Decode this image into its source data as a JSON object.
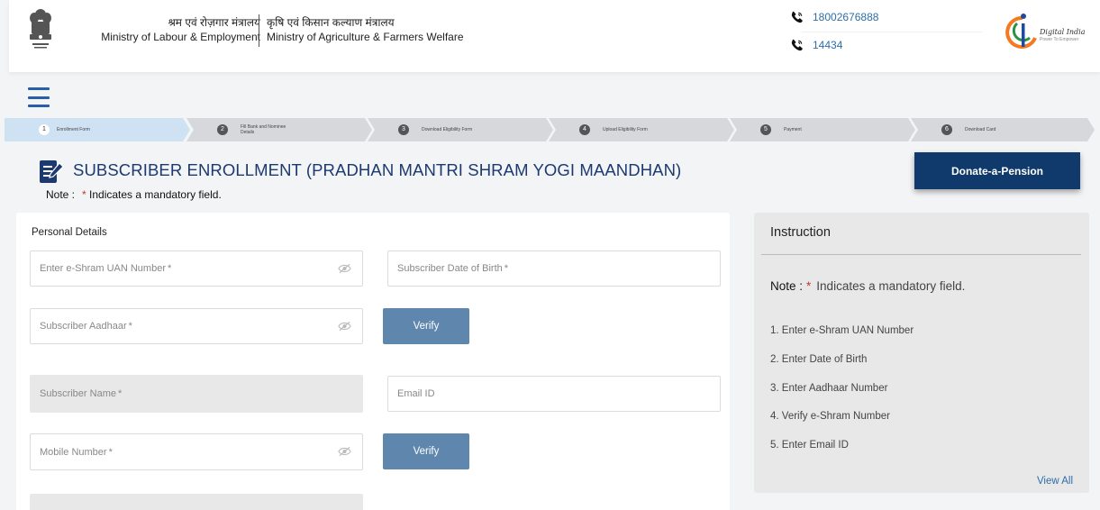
{
  "header": {
    "ministry_1_hindi": "श्रम एवं रोज़गार मंत्रालय",
    "ministry_1_english": "Ministry of Labour & Employment",
    "ministry_2_hindi": "कृषि एवं किसान कल्याण मंत्रालय",
    "ministry_2_english": "Ministry of Agriculture & Farmers Welfare",
    "phone_1": "18002676888",
    "phone_2": "14434",
    "emblem_icon": "national-emblem-icon",
    "logo_text": "Digital India",
    "logo_subtext": "Power To Empower"
  },
  "stepper": {
    "steps": [
      {
        "num": "1",
        "label": "Enrollment Form"
      },
      {
        "num": "2",
        "label": "Fill Bank and Nominee Details"
      },
      {
        "num": "3",
        "label": "Download Eligibility Form"
      },
      {
        "num": "4",
        "label": "Upload Eligibility Form"
      },
      {
        "num": "5",
        "label": "Payment"
      },
      {
        "num": "6",
        "label": "Download Card"
      }
    ]
  },
  "page": {
    "title": "SUBSCRIBER ENROLLMENT (PRADHAN MANTRI SHRAM YOGI MAANDHAN)",
    "note_label": "Note :",
    "note_text": "Indicates a mandatory field.",
    "donate_label": "Donate-a-Pension"
  },
  "form": {
    "section_title": "Personal Details",
    "uan_placeholder": "Enter e-Shram UAN Number",
    "dob_placeholder": "Subscriber Date of Birth",
    "aadhaar_placeholder": "Subscriber Aadhaar",
    "name_placeholder": "Subscriber Name",
    "email_placeholder": "Email ID",
    "mobile_placeholder": "Mobile Number",
    "verify_label": "Verify",
    "required_mark": "*"
  },
  "instructions": {
    "title": "Instruction",
    "note_label": "Note :",
    "note_star": "*",
    "note_text": "Indicates a mandatory field.",
    "items": [
      {
        "num": "1.",
        "text": "Enter e-Shram UAN Number"
      },
      {
        "num": "2.",
        "text": "Enter Date of Birth"
      },
      {
        "num": "3.",
        "text": "Enter Aadhaar Number"
      },
      {
        "num": "4.",
        "text": "Verify e-Shram Number"
      },
      {
        "num": "5.",
        "text": "Enter Email ID"
      }
    ],
    "view_all": "View All"
  },
  "colors": {
    "accent": "#0f3a6b",
    "link": "#2d6ea8",
    "verify": "#5f87ad",
    "required": "#c0392b"
  }
}
